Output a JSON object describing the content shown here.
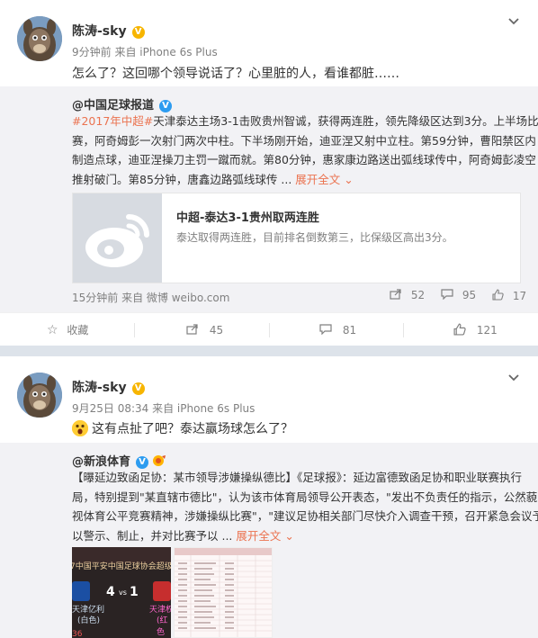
{
  "post1": {
    "user": "陈涛-sky",
    "meta": "9分钟前 来自 iPhone 6s Plus",
    "text": "怎么了？这回哪个领导说话了？心里脏的人，看谁都脏……",
    "repost": {
      "name": "@中国足球报道",
      "hashtag": "#2017年中超#",
      "line1": "天津泰达主场3-1击败贵州智诚，获得两连胜，领先降级区达到3分。上半场比",
      "line2": "赛，阿奇姆彭一次射门两次中柱。下半场刚开始，迪亚涅又射中立柱。第59分钟，曹阳禁区内",
      "line3": "制造点球，迪亚涅操刀主罚一蹴而就。第80分钟，惠家康边路送出弧线球传中，阿奇姆彭凌空",
      "line4": "推射破门。第85分钟，唐鑫边路弧线球传 ...",
      "expand": "展开全文",
      "card_title": "中超-泰达3-1贵州取两连胜",
      "card_desc": "泰达取得两连胜，目前排名倒数第三，比保级区高出3分。",
      "foot": "15分钟前 来自 微博 weibo.com",
      "forward_count": "52",
      "comment_count": "95",
      "like_count": "17"
    },
    "actions": {
      "favorite": "收藏",
      "forward": "45",
      "comment": "81",
      "like": "121"
    }
  },
  "post2": {
    "user": "陈涛-sky",
    "meta": "9月25日 08:34 来自 iPhone 6s Plus",
    "text": "这有点扯了吧？泰达赢场球怎么了？",
    "repost": {
      "name": "@新浪体育",
      "line1": "【曝延边致函足协：某市领导涉嫌操纵德比】《足球报》：延边富德致函足协和职业联赛执行",
      "line2": "局，特别提到\"某直辖市德比\"，认为该市体育局领导公开表态，\"发出不负责任的指示，公然藐",
      "line3": "视体育公平竞赛精神，涉嫌操纵比赛\"，\"建议足协相关部门尽快介入调查干预，召开紧急会议予",
      "line4": "以警示、制止，并对比赛予以 ...",
      "expand": "展开全文",
      "media1_banner": "7中国平安中国足球协会超级",
      "media1_left_team": "天津亿利",
      "media1_left_sub": "(白色)",
      "media1_right_team": "天津权",
      "media1_right_sub": "(红色",
      "media1_score_left": "4",
      "media1_vs": "vs",
      "media1_score_right": "1",
      "media1_time": "36"
    }
  },
  "colors": {
    "orange": "#eb7350",
    "link": "#eb7350",
    "verified": "#f7b500",
    "verified_blue": "#2d9cf0"
  }
}
